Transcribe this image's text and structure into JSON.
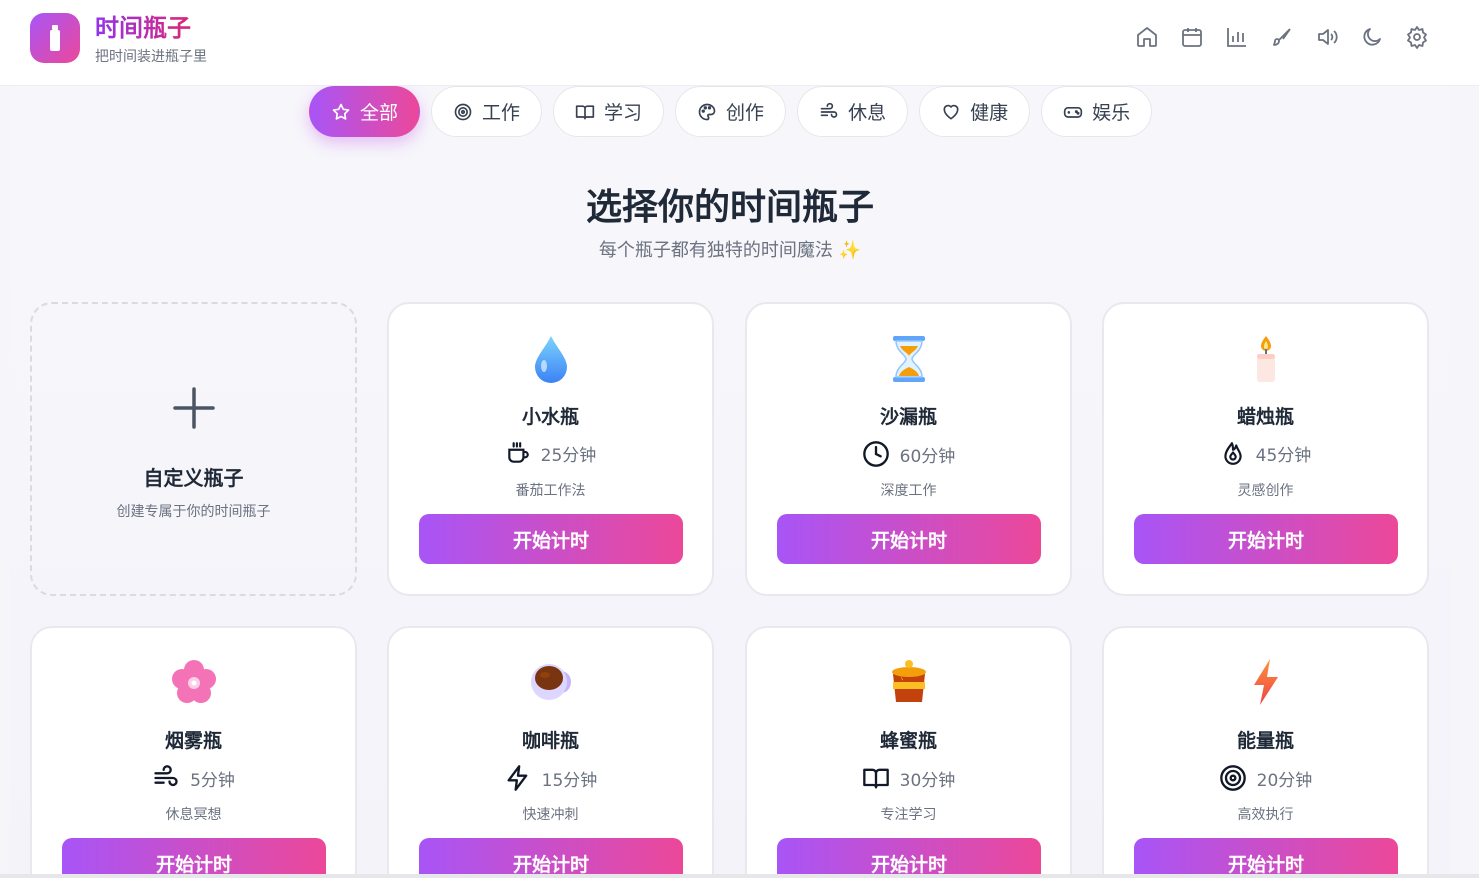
{
  "app": {
    "title": "时间瓶子",
    "subtitle": "把时间装进瓶子里"
  },
  "nav_icons": [
    "home-icon",
    "calendar-icon",
    "chart-icon",
    "brush-icon",
    "volume-icon",
    "moon-icon",
    "settings-icon"
  ],
  "tabs": [
    {
      "label": "全部",
      "icon": "star-icon",
      "active": true
    },
    {
      "label": "工作",
      "icon": "target-icon"
    },
    {
      "label": "学习",
      "icon": "book-icon"
    },
    {
      "label": "创作",
      "icon": "palette-icon"
    },
    {
      "label": "休息",
      "icon": "wind-icon"
    },
    {
      "label": "健康",
      "icon": "heart-icon"
    },
    {
      "label": "娱乐",
      "icon": "gamepad-icon"
    }
  ],
  "hero": {
    "title": "选择你的时间瓶子",
    "subtitle": "每个瓶子都有独特的时间魔法 ✨"
  },
  "custom": {
    "title": "自定义瓶子",
    "subtitle": "创建专属于你的时间瓶子"
  },
  "start_label": "开始计时",
  "bottles": [
    {
      "emoji": "💧",
      "name": "小水瓶",
      "duration": "25分钟",
      "meta_icon": "coffee-icon",
      "desc": "番茄工作法"
    },
    {
      "emoji": "⏳",
      "name": "沙漏瓶",
      "duration": "60分钟",
      "meta_icon": "clock-icon",
      "desc": "深度工作"
    },
    {
      "emoji": "🕯️",
      "name": "蜡烛瓶",
      "duration": "45分钟",
      "meta_icon": "flame-icon",
      "desc": "灵感创作"
    },
    {
      "emoji": "🌸",
      "name": "烟雾瓶",
      "duration": "5分钟",
      "meta_icon": "wind-icon",
      "desc": "休息冥想"
    },
    {
      "emoji": "☕",
      "name": "咖啡瓶",
      "duration": "15分钟",
      "meta_icon": "zap-icon",
      "desc": "快速冲刺"
    },
    {
      "emoji": "🍯",
      "name": "蜂蜜瓶",
      "duration": "30分钟",
      "meta_icon": "book-icon",
      "desc": "专注学习"
    },
    {
      "emoji": "⚡",
      "name": "能量瓶",
      "duration": "20分钟",
      "meta_icon": "target-icon",
      "desc": "高效执行"
    }
  ]
}
